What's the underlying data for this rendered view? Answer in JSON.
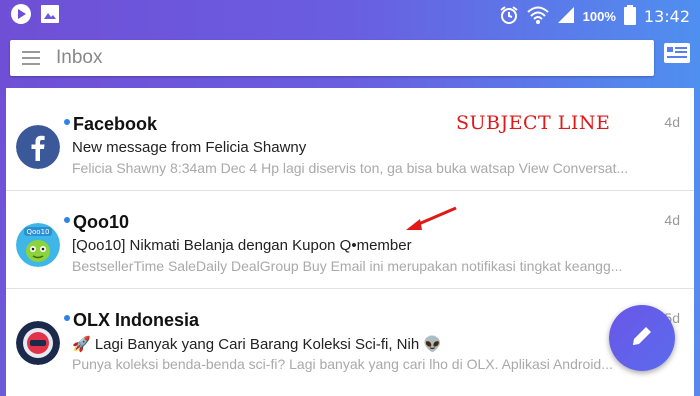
{
  "status_bar": {
    "battery_pct": "100%",
    "time": "13:42"
  },
  "search": {
    "placeholder": "Inbox"
  },
  "messages": [
    {
      "sender": "Facebook",
      "subject": "New message from Felicia Shawny",
      "snippet": "Felicia Shawny 8:34am Dec 4 Hp lagi diservis ton, ga bisa buka watsap View Conversat...",
      "age": "4d",
      "avatar_icon": "facebook-logo-icon"
    },
    {
      "sender": "Qoo10",
      "subject": "[Qoo10] Nikmati Belanja dengan Kupon Q•member",
      "snippet": "BestsellerTime SaleDaily DealGroup Buy Email ini merupakan notifikasi tingkat keangg...",
      "age": "4d",
      "avatar_icon": "qoo10-logo-icon"
    },
    {
      "sender": "OLX Indonesia",
      "subject": "🚀 Lagi Banyak yang Cari Barang Koleksi Sci-fi, Nih 👽",
      "snippet": "Punya koleksi benda-benda sci-fi? Lagi banyak yang cari lho di OLX. Aplikasi Android...",
      "age": "5d",
      "avatar_icon": "olx-logo-icon"
    }
  ],
  "annotation": {
    "label": "SUBJECT LINE",
    "color": "#e01818"
  },
  "colors": {
    "accent_start": "#6f4fd6",
    "accent_end": "#4f8ff0",
    "unread_dot": "#2f83e6"
  }
}
